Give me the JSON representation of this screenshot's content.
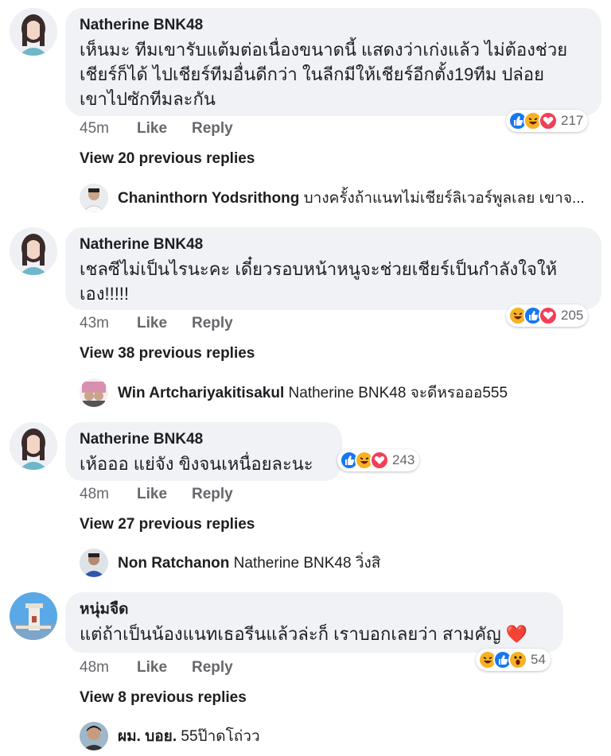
{
  "comments": [
    {
      "author": "Natherine BNK48",
      "text": "เห็นมะ ทีมเขารับแต้มต่อเนื่องขนาดนี้ แสดงว่าเก่งแล้ว ไม่ต้องช่วย\nเชียร์ก็ได้ ไปเชียร์ทีมอื่นดีกว่า ในลีกมีให้เชียร์อีกตั้ง19ทีม ปล่อย\nเขาไปซักทีมละกัน",
      "time": "45m",
      "like_label": "Like",
      "reply_label": "Reply",
      "reaction_icons": [
        "like",
        "haha",
        "love"
      ],
      "reaction_count": "217",
      "view_previous": "View 20 previous replies",
      "latest_reply": {
        "name": "Chaninthorn Yodsrithong",
        "text": "บางครั้งถ้าแนทไม่เชียร์ลิเวอร์พูลเลย เขาจ..."
      }
    },
    {
      "author": "Natherine BNK48",
      "text": "เชลซีไม่เป็นไรนะคะ เดี๋ยวรอบหน้าหนูจะช่วยเชียร์เป็นกำลังใจให้\nเอง!!!!!",
      "time": "43m",
      "like_label": "Like",
      "reply_label": "Reply",
      "reaction_icons": [
        "haha",
        "like",
        "love"
      ],
      "reaction_count": "205",
      "view_previous": "View 38 previous replies",
      "latest_reply": {
        "name": "Win Artchariyakitisakul",
        "text": "Natherine BNK48 จะดีหรอออ555"
      }
    },
    {
      "author": "Natherine BNK48",
      "text": "เห้อออ แย่จัง ขิงจนเหนื่อยละนะ",
      "time": "48m",
      "like_label": "Like",
      "reply_label": "Reply",
      "reaction_icons": [
        "like",
        "haha",
        "love"
      ],
      "reaction_count": "243",
      "view_previous": "View 27 previous replies",
      "latest_reply": {
        "name": "Non Ratchanon",
        "text": "Natherine BNK48 วิ่งสิ"
      }
    },
    {
      "author": "หนุ่มจืด",
      "text": "แต่ถ้าเป็นน้องแนทเธอรีนแล้วล่ะก็ เราบอกเลยว่า สามคัญ ❤️",
      "time": "48m",
      "like_label": "Like",
      "reply_label": "Reply",
      "reaction_icons": [
        "haha",
        "like",
        "wow"
      ],
      "reaction_count": "54",
      "view_previous": "View 8 previous replies",
      "latest_reply": {
        "name": "ผม. บอย.",
        "text": "55ป๊าดโถ่วว"
      }
    }
  ],
  "colors": {
    "bubble": "#f0f2f5",
    "like": "#1877f2",
    "haha": "#f7b125",
    "love": "#f33e58",
    "meta_text": "#65676b"
  }
}
